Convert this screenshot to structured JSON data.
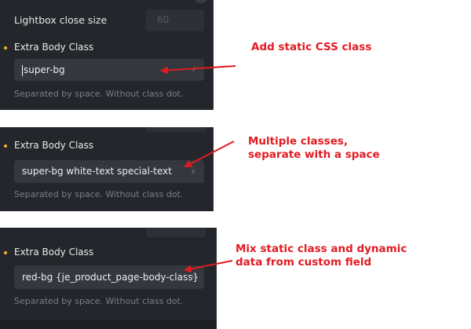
{
  "panel1": {
    "lightbox_label": "Lightbox close size",
    "lightbox_value": "60",
    "field_label": "Extra Body Class",
    "input_value": "super-bg",
    "helper": "Separated by space. Without class dot."
  },
  "panel2": {
    "field_label": "Extra Body Class",
    "input_value": "super-bg white-text special-text",
    "helper": "Separated by space. Without class dot."
  },
  "panel3": {
    "field_label": "Extra Body Class",
    "input_value": "red-bg {je_product_page-body-class}",
    "helper": "Separated by space. Without class dot."
  },
  "annotations": {
    "a1": "Add static CSS class",
    "a2_line1": "Multiple classes,",
    "a2_line2": "separate with a space",
    "a3_line1": "Mix static class and dynamic",
    "a3_line2": "data from custom field"
  },
  "colors": {
    "panel_bg": "#23262b",
    "input_bg": "#34383e",
    "accent_dot": "#f0b431",
    "annotation": "#e11b22"
  },
  "icons": {
    "dynamic_data": "bolt-icon",
    "required_marker": "dot-icon"
  }
}
